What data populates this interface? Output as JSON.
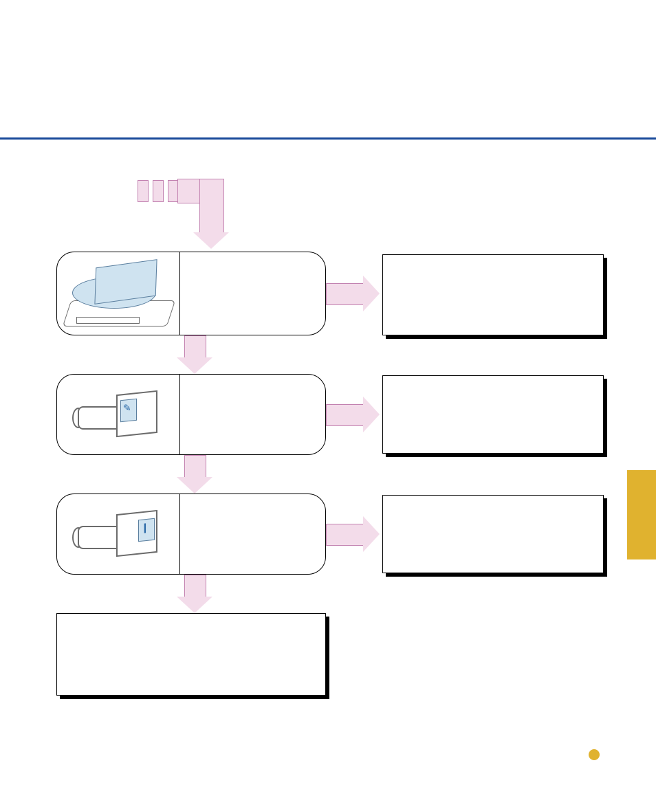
{
  "steps": [
    {
      "id": "scan-originals",
      "illustration": "scanner"
    },
    {
      "id": "toner-step-1",
      "illustration": "toner-left-panel"
    },
    {
      "id": "toner-step-2",
      "illustration": "toner-right-panel"
    }
  ],
  "side_notes": [
    {
      "id": "note-1"
    },
    {
      "id": "note-2"
    },
    {
      "id": "note-3"
    }
  ],
  "final_box": {
    "id": "summary"
  }
}
